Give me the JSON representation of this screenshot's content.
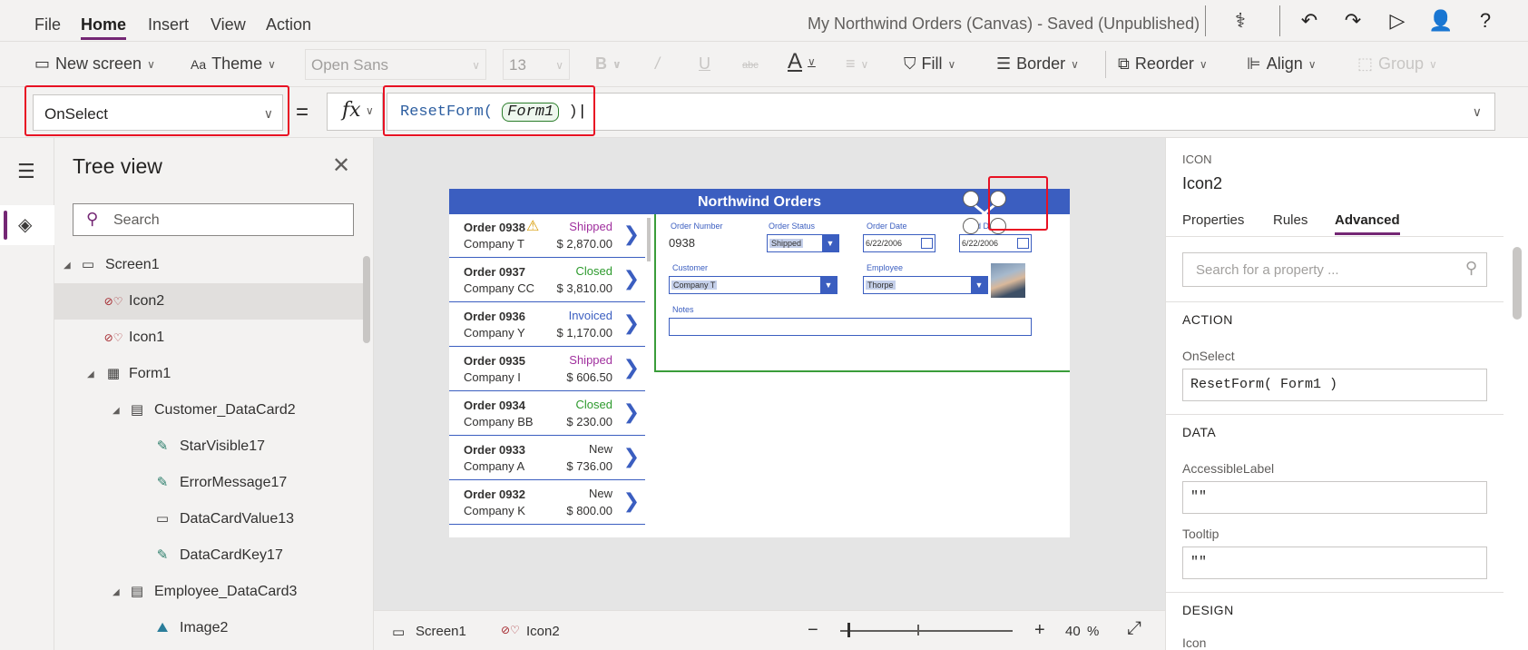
{
  "menu": {
    "file": "File",
    "home": "Home",
    "insert": "Insert",
    "view": "View",
    "action": "Action",
    "app_title": "My Northwind Orders (Canvas) - Saved (Unpublished)"
  },
  "toolbar": {
    "new_screen": "New screen",
    "theme": "Theme",
    "font": "Open Sans",
    "font_size": "13",
    "bold": "B",
    "italic": "/",
    "underline": "U",
    "strike": "abc",
    "font_color": "A",
    "fill": "Fill",
    "border": "Border",
    "reorder": "Reorder",
    "align": "Align",
    "group": "Group"
  },
  "formula": {
    "property": "OnSelect",
    "equals": "=",
    "fx": "fx",
    "func": "ResetForm(",
    "arg": "Form1",
    "close": ")"
  },
  "tree": {
    "title": "Tree view",
    "search_placeholder": "Search",
    "items": [
      {
        "label": "Screen1"
      },
      {
        "label": "Icon2"
      },
      {
        "label": "Icon1"
      },
      {
        "label": "Form1"
      },
      {
        "label": "Customer_DataCard2"
      },
      {
        "label": "StarVisible17"
      },
      {
        "label": "ErrorMessage17"
      },
      {
        "label": "DataCardValue13"
      },
      {
        "label": "DataCardKey17"
      },
      {
        "label": "Employee_DataCard3"
      },
      {
        "label": "Image2"
      }
    ]
  },
  "app": {
    "title": "Northwind Orders",
    "orders": [
      {
        "num": "Order 0938",
        "company": "Company T",
        "status": "Shipped",
        "amount": "$ 2,870.00",
        "color": "#a0309e"
      },
      {
        "num": "Order 0937",
        "company": "Company CC",
        "status": "Closed",
        "amount": "$ 3,810.00",
        "color": "#2d9a2d"
      },
      {
        "num": "Order 0936",
        "company": "Company Y",
        "status": "Invoiced",
        "amount": "$ 1,170.00",
        "color": "#3b5ec0"
      },
      {
        "num": "Order 0935",
        "company": "Company I",
        "status": "Shipped",
        "amount": "$ 606.50",
        "color": "#a0309e"
      },
      {
        "num": "Order 0934",
        "company": "Company BB",
        "status": "Closed",
        "amount": "$ 230.00",
        "color": "#2d9a2d"
      },
      {
        "num": "Order 0933",
        "company": "Company A",
        "status": "New",
        "amount": "$ 736.00",
        "color": "#323130"
      },
      {
        "num": "Order 0932",
        "company": "Company K",
        "status": "New",
        "amount": "$ 800.00",
        "color": "#323130"
      }
    ],
    "form": {
      "order_number_label": "Order Number",
      "order_number": "0938",
      "order_status_label": "Order Status",
      "order_status": "Shipped",
      "order_date_label": "Order Date",
      "order_date": "6/22/2006",
      "paid_date_label": "Paid Date",
      "paid_date": "6/22/2006",
      "customer_label": "Customer",
      "customer": "Company T",
      "employee_label": "Employee",
      "employee": "Thorpe",
      "notes_label": "Notes"
    }
  },
  "statusbar": {
    "screen": "Screen1",
    "control": "Icon2",
    "minus": "−",
    "plus": "+",
    "zoom": "40",
    "pct": "%",
    "zoom_value": 0.4
  },
  "props": {
    "type": "ICON",
    "name": "Icon2",
    "tabs": [
      "Properties",
      "Rules",
      "Advanced"
    ],
    "search_placeholder": "Search for a property ...",
    "action_header": "ACTION",
    "onselect_label": "OnSelect",
    "onselect_value": "ResetForm( Form1 )",
    "data_header": "DATA",
    "accessible_label": "AccessibleLabel",
    "accessible_value": "\"\"",
    "tooltip_label": "Tooltip",
    "tooltip_value": "\"\"",
    "design_header": "DESIGN",
    "icon_label": "Icon"
  },
  "colors": {
    "accent": "#742774",
    "app_blue": "#3b5ec0",
    "highlight_red": "#e81123"
  }
}
